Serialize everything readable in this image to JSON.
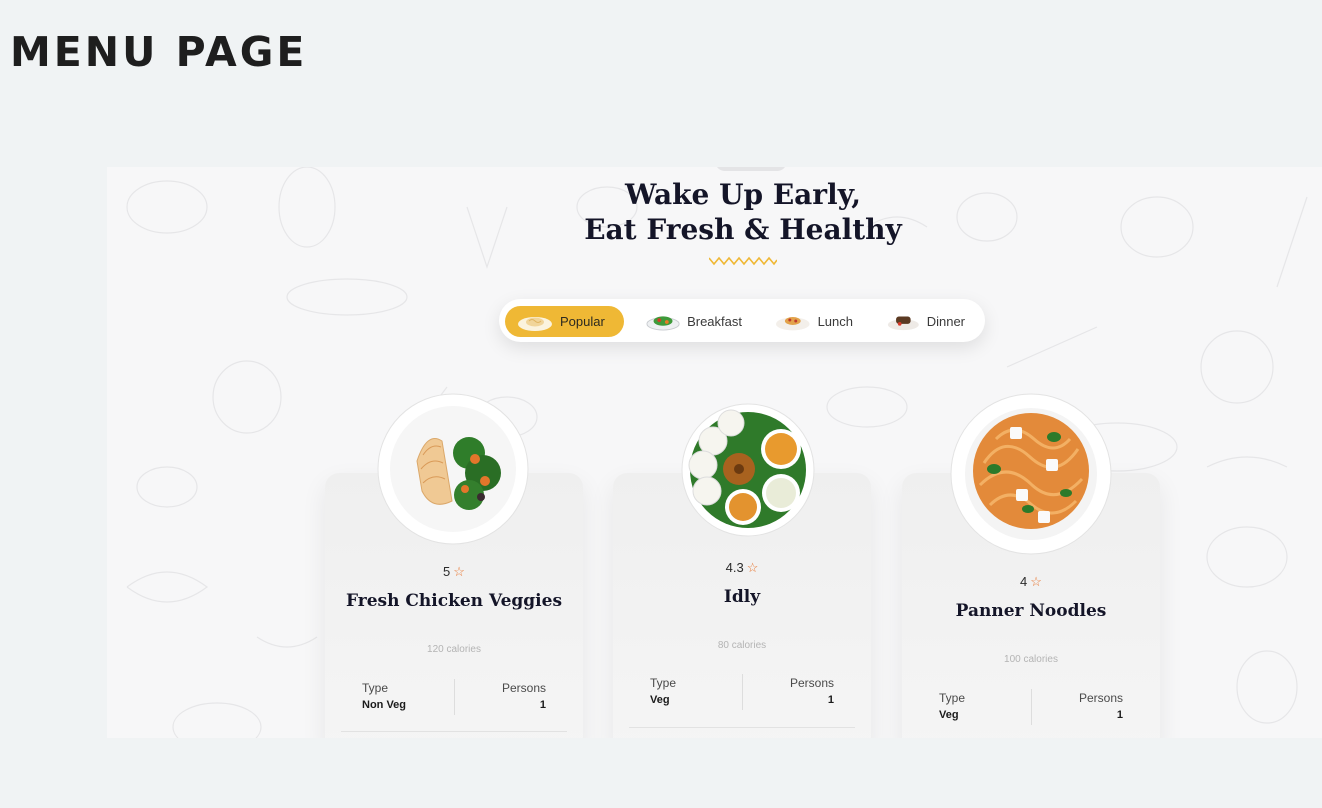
{
  "page_heading": "MENU PAGE",
  "hero": {
    "title_line1": "Wake Up Early,",
    "title_line2": "Eat Fresh & Healthy"
  },
  "tabs": [
    {
      "label": "Popular",
      "icon": "pasta-plate-icon",
      "active": true
    },
    {
      "label": "Breakfast",
      "icon": "salad-plate-icon",
      "active": false
    },
    {
      "label": "Lunch",
      "icon": "lunch-plate-icon",
      "active": false
    },
    {
      "label": "Dinner",
      "icon": "dinner-plate-icon",
      "active": false
    }
  ],
  "dishes": [
    {
      "rating": "5",
      "name": "Fresh Chicken Veggies",
      "calories": "120 calories",
      "type_label": "Type",
      "type_value": "Non Veg",
      "persons_label": "Persons",
      "persons_value": "1",
      "image": "chicken-veggies-plate"
    },
    {
      "rating": "4.3",
      "name": "Idly",
      "calories": "80 calories",
      "type_label": "Type",
      "type_value": "Veg",
      "persons_label": "Persons",
      "persons_value": "1",
      "image": "idly-plate"
    },
    {
      "rating": "4",
      "name": "Panner Noodles",
      "calories": "100 calories",
      "type_label": "Type",
      "type_value": "Veg",
      "persons_label": "Persons",
      "persons_value": "1",
      "image": "noodles-plate"
    }
  ],
  "colors": {
    "accent": "#efb835",
    "star": "#e8752f",
    "title": "#141528",
    "page_background": "#f0f3f4"
  }
}
